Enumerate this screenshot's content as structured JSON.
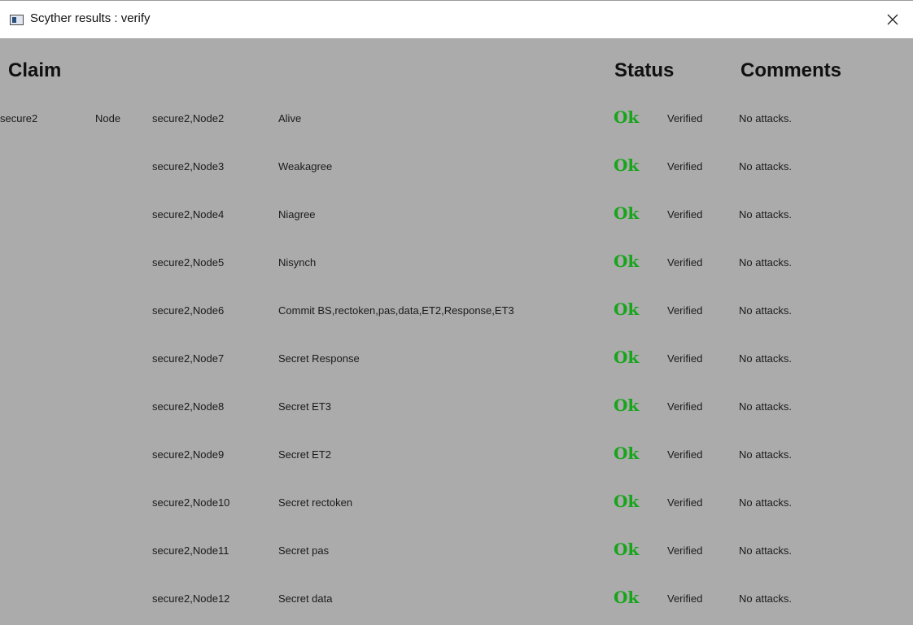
{
  "window": {
    "title": "Scyther results : verify",
    "close_symbol": "✕"
  },
  "headers": {
    "claim": "Claim",
    "status": "Status",
    "comments": "Comments"
  },
  "colors": {
    "ok": "#17a51b",
    "background": "#ababab"
  },
  "rows": [
    {
      "protocol": "secure2",
      "role": "Node",
      "id": "secure2,Node2",
      "claim": "Alive",
      "status": "Ok",
      "verdict": "Verified",
      "comment": "No attacks."
    },
    {
      "protocol": "",
      "role": "",
      "id": "secure2,Node3",
      "claim": "Weakagree",
      "status": "Ok",
      "verdict": "Verified",
      "comment": "No attacks."
    },
    {
      "protocol": "",
      "role": "",
      "id": "secure2,Node4",
      "claim": "Niagree",
      "status": "Ok",
      "verdict": "Verified",
      "comment": "No attacks."
    },
    {
      "protocol": "",
      "role": "",
      "id": "secure2,Node5",
      "claim": "Nisynch",
      "status": "Ok",
      "verdict": "Verified",
      "comment": "No attacks."
    },
    {
      "protocol": "",
      "role": "",
      "id": "secure2,Node6",
      "claim": "Commit BS,rectoken,pas,data,ET2,Response,ET3",
      "status": "Ok",
      "verdict": "Verified",
      "comment": "No attacks."
    },
    {
      "protocol": "",
      "role": "",
      "id": "secure2,Node7",
      "claim": "Secret Response",
      "status": "Ok",
      "verdict": "Verified",
      "comment": "No attacks."
    },
    {
      "protocol": "",
      "role": "",
      "id": "secure2,Node8",
      "claim": "Secret ET3",
      "status": "Ok",
      "verdict": "Verified",
      "comment": "No attacks."
    },
    {
      "protocol": "",
      "role": "",
      "id": "secure2,Node9",
      "claim": "Secret ET2",
      "status": "Ok",
      "verdict": "Verified",
      "comment": "No attacks."
    },
    {
      "protocol": "",
      "role": "",
      "id": "secure2,Node10",
      "claim": "Secret rectoken",
      "status": "Ok",
      "verdict": "Verified",
      "comment": "No attacks."
    },
    {
      "protocol": "",
      "role": "",
      "id": "secure2,Node11",
      "claim": "Secret pas",
      "status": "Ok",
      "verdict": "Verified",
      "comment": "No attacks."
    },
    {
      "protocol": "",
      "role": "",
      "id": "secure2,Node12",
      "claim": "Secret data",
      "status": "Ok",
      "verdict": "Verified",
      "comment": "No attacks."
    }
  ]
}
